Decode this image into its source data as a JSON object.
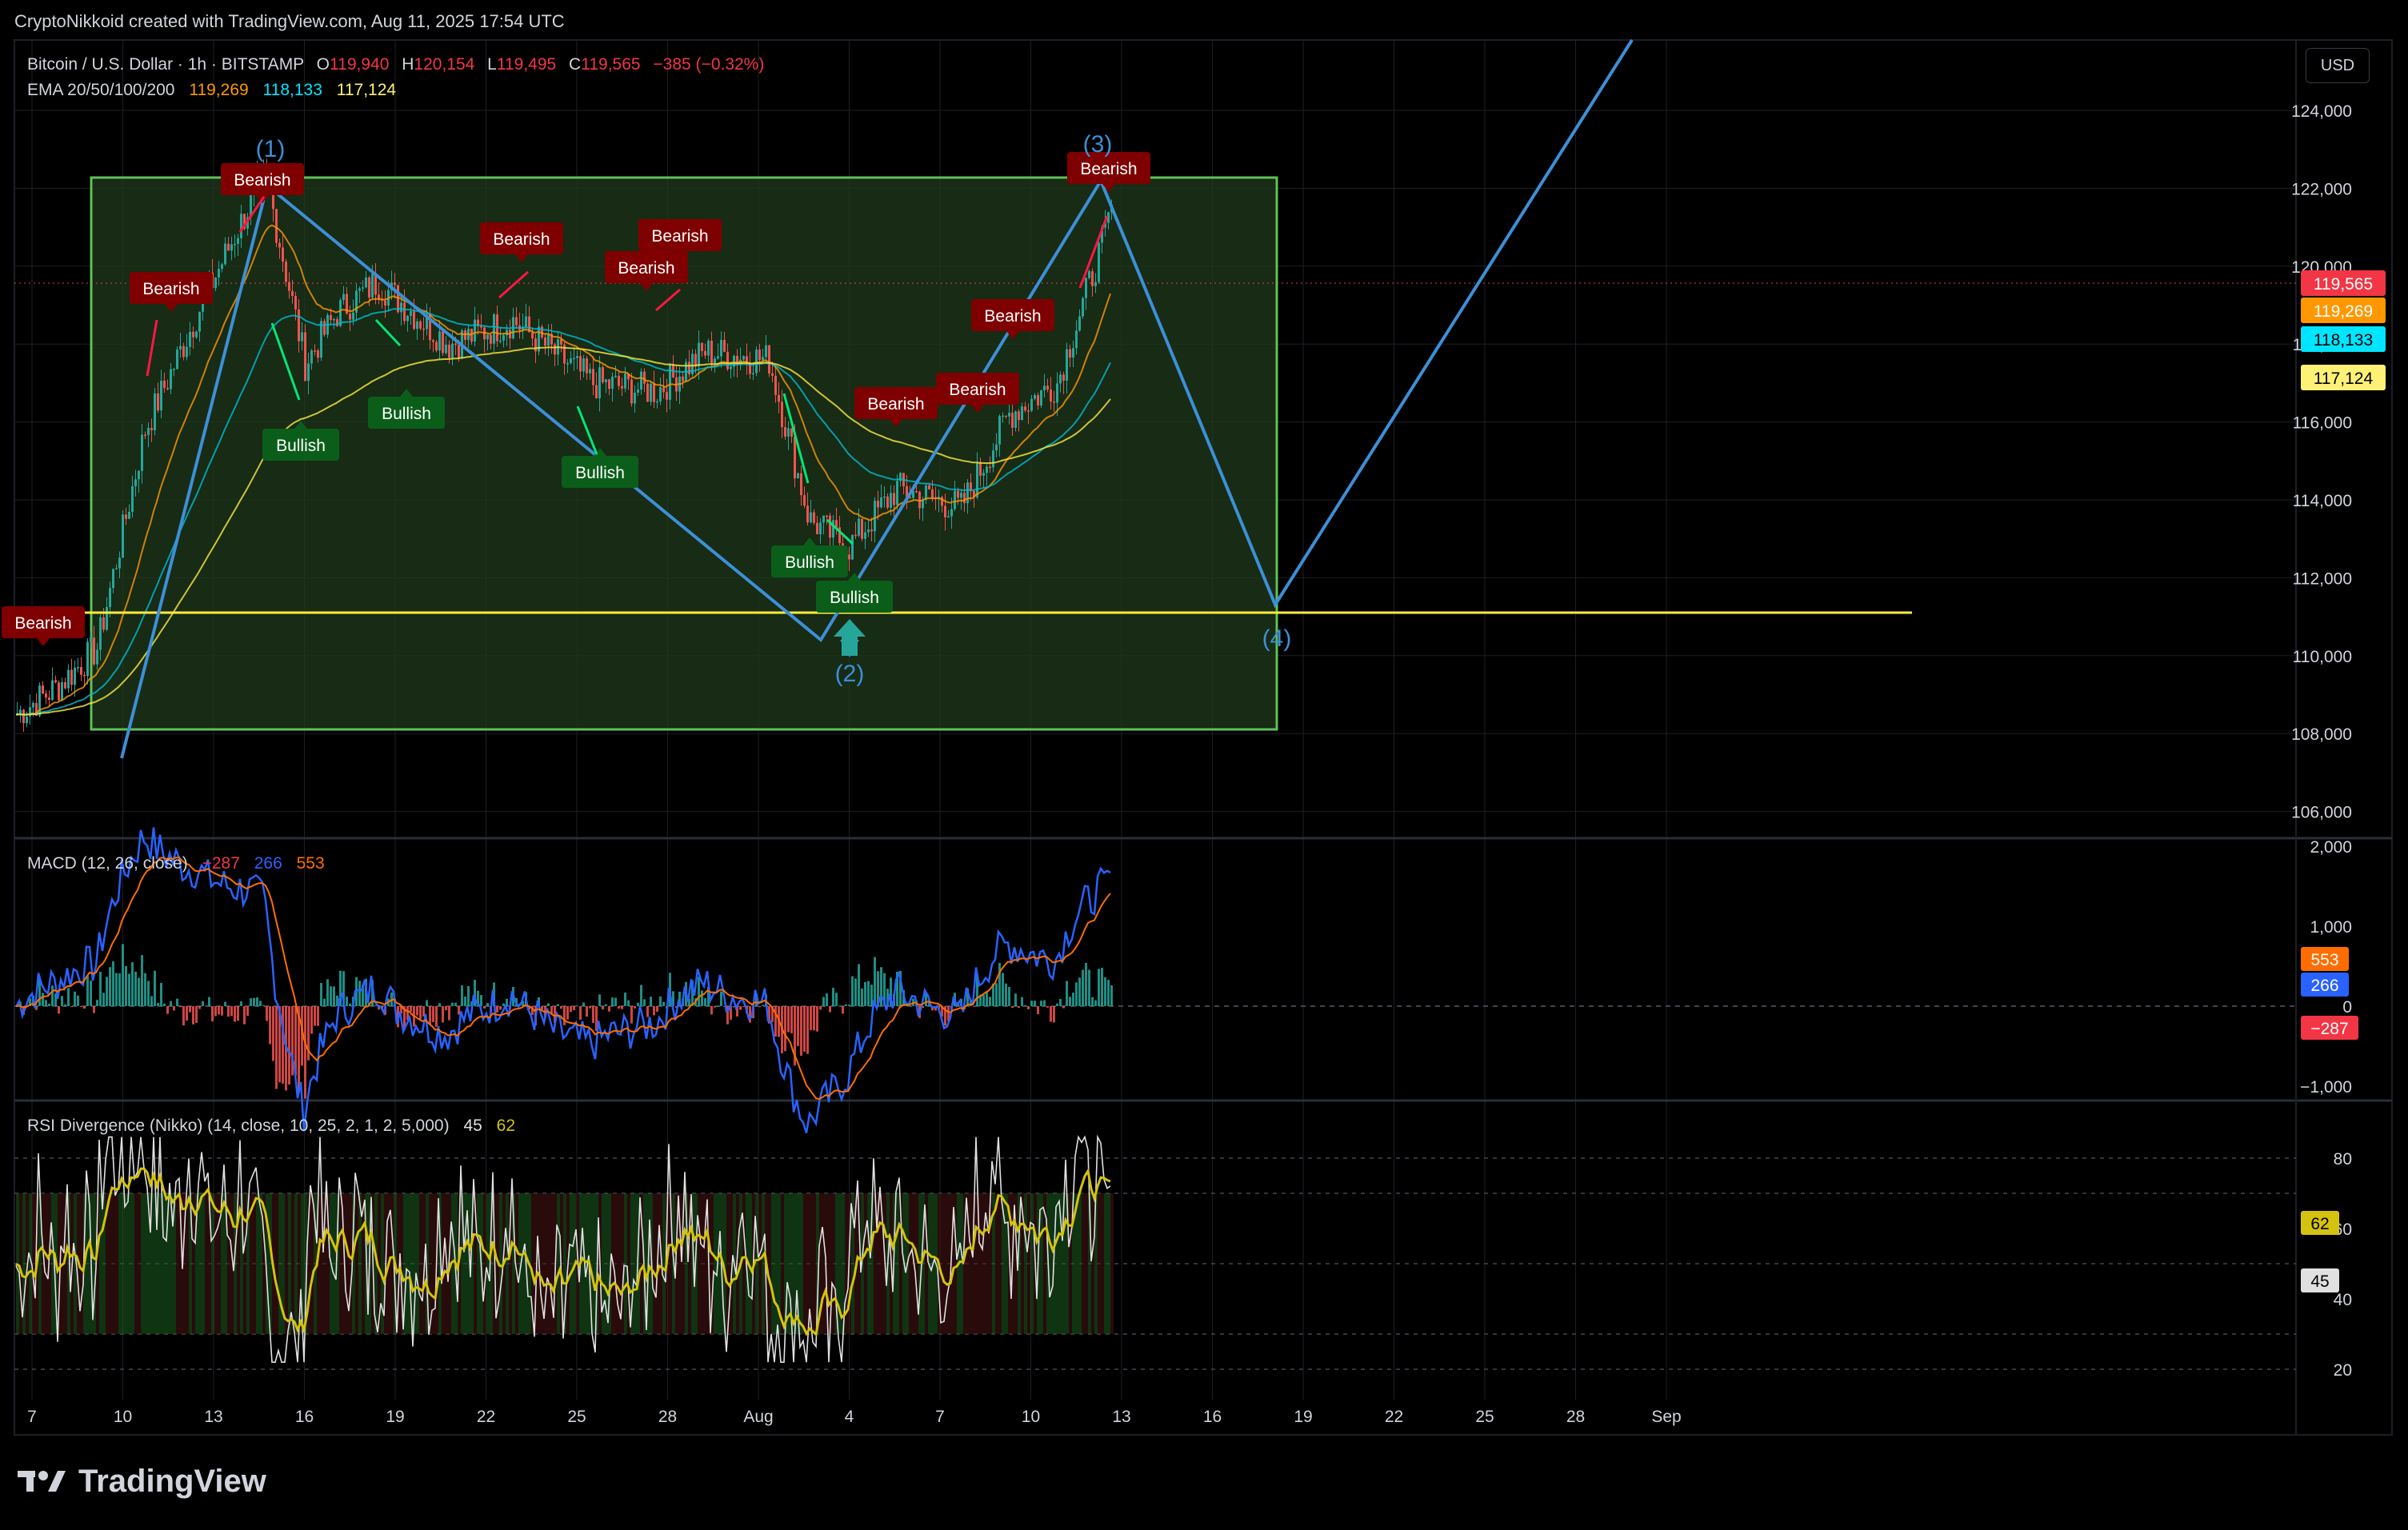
{
  "header": {
    "attribution": "CryptoNikkoid created with TradingView.com, Aug 11, 2025 17:54 UTC"
  },
  "symbol": {
    "name": "Bitcoin / U.S. Dollar · 1h · BITSTAMP",
    "o_label": "O",
    "o": "119,940",
    "h_label": "H",
    "h": "120,154",
    "l_label": "L",
    "l": "119,495",
    "c_label": "C",
    "c": "119,565",
    "change": "−385 (−0.32%)"
  },
  "ema": {
    "label": "EMA 20/50/100/200",
    "v1": "119,269",
    "v2": "118,133",
    "v3": "117,124"
  },
  "currency_button": "USD",
  "price_axis": {
    "ticks": [
      "124,000",
      "122,000",
      "120,000",
      "118,000",
      "116,000",
      "114,000",
      "112,000",
      "110,000",
      "108,000",
      "106,000"
    ]
  },
  "price_tags": {
    "last": "119,565",
    "ema20": "119,269",
    "ema50": "118,133",
    "ema100": "117,124"
  },
  "macd": {
    "label": "MACD (12, 26, close)",
    "v_hist": "−287",
    "v_macd": "266",
    "v_signal": "553",
    "ticks": [
      "2,000",
      "1,000",
      "0",
      "−1,000"
    ],
    "tags": {
      "signal": "553",
      "macd": "266",
      "hist": "−287"
    }
  },
  "rsi": {
    "label": "RSI Divergence (Nikko) (14, close, 10, 25, 2, 1, 2, 5,000)",
    "v1": "45",
    "v2": "62",
    "ticks": [
      "80",
      "60",
      "40",
      "20"
    ],
    "tags": {
      "smooth": "62",
      "rsi": "45"
    }
  },
  "time_axis": [
    "7",
    "10",
    "13",
    "16",
    "19",
    "22",
    "25",
    "28",
    "Aug",
    "4",
    "7",
    "10",
    "13",
    "16",
    "19",
    "22",
    "25",
    "28",
    "Sep"
  ],
  "signals": {
    "bearish": "Bearish",
    "bullish": "Bullish"
  },
  "waves": [
    "(1)",
    "(2)",
    "(3)",
    "(4)"
  ],
  "brand": "TradingView",
  "colors": {
    "background": "#000000",
    "grid": "#1c1f26",
    "up": "#26a69a",
    "down": "#ef5350",
    "ema20": "#ff9800",
    "ema50": "#00bcd4",
    "ema100": "#ffeb3b",
    "wave": "#3d8fd6",
    "zone": "#3a6b2e",
    "support": "#ffeb3b",
    "bearish_tag": "#7f0000",
    "bullish_tag": "#0b5e1a",
    "macd": "#2962ff",
    "signal": "#ff6d00",
    "rsi": "#e0e0e0",
    "rsi_smooth": "#d4c20f"
  },
  "chart_data": [
    {
      "type": "candlestick",
      "title": "Bitcoin / U.S. Dollar · 1h · BITSTAMP",
      "ylim": [
        105000,
        125000
      ],
      "x_range": [
        "Jul 7",
        "Sep 1"
      ],
      "key_points": [
        {
          "label": "(1)",
          "date": "Jul 14",
          "price": 123200
        },
        {
          "label": "(2)",
          "date": "Aug 2",
          "price": 112000
        },
        {
          "label": "(3)",
          "date": "Aug 11",
          "price": 122300
        },
        {
          "label": "(4)",
          "date": "Aug 17",
          "price": 111300
        }
      ],
      "support_level": 111100,
      "last_close": 119565,
      "ema": {
        "20": 119269,
        "50": 118133,
        "100": 117124
      }
    },
    {
      "type": "line",
      "title": "MACD (12, 26, close)",
      "ylim": [
        -1100,
        2000
      ],
      "series": [
        {
          "name": "MACD",
          "last": 266
        },
        {
          "name": "Signal",
          "last": 553
        },
        {
          "name": "Histogram",
          "last": -287
        }
      ]
    },
    {
      "type": "line",
      "title": "RSI Divergence (Nikko) (14, close, 10, 25, 2, 1, 2, 5,000)",
      "ylim": [
        15,
        90
      ],
      "levels": [
        80,
        70,
        50,
        30,
        20
      ],
      "series": [
        {
          "name": "RSI",
          "last": 45
        },
        {
          "name": "Smoothed",
          "last": 62
        }
      ]
    }
  ]
}
